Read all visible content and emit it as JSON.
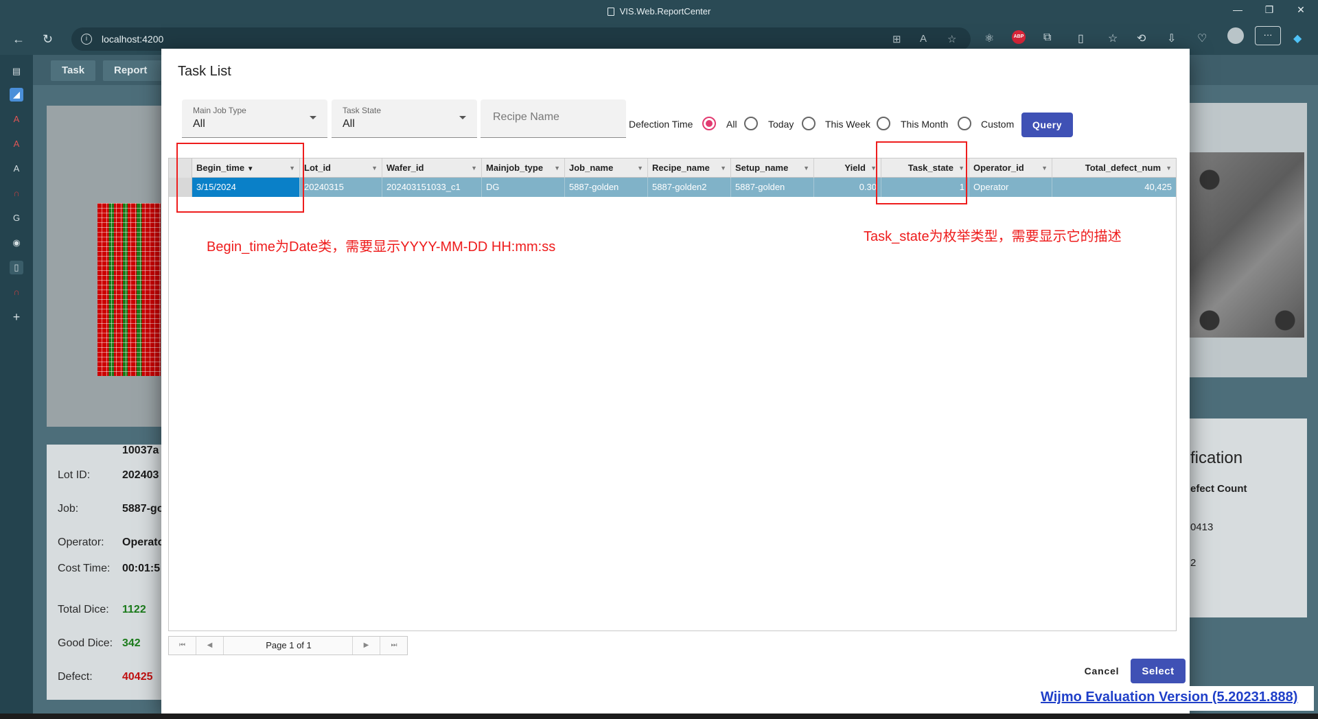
{
  "browser": {
    "window_title": "VIS.Web.ReportCenter",
    "url": "localhost:4200",
    "win_minimize": "—",
    "win_restore": "❐",
    "win_close": "✕",
    "abp_label": "ABP",
    "more_label": "···"
  },
  "background": {
    "tabs": [
      "Task",
      "Report Ex"
    ],
    "info_header": "10037a",
    "rows": [
      {
        "label": "Lot ID:",
        "value": "202403"
      },
      {
        "label": "Job:",
        "value": "5887-go"
      },
      {
        "label": "Operator:",
        "value": "Operato"
      },
      {
        "label": "Cost Time:",
        "value": "00:01:5"
      },
      {
        "label": "Total Dice:",
        "value": "1122"
      },
      {
        "label": "Good Dice:",
        "value": "342"
      },
      {
        "label": "Defect:",
        "value": "40425"
      }
    ],
    "right_title": "fication",
    "right_sub": "efect Count",
    "right_val1": "0413",
    "right_val2": "2",
    "colors": {
      "total": "#1a7a1a",
      "good": "#1a7a1a",
      "defect": "#c01010"
    }
  },
  "dialog": {
    "title": "Task List",
    "main_job_type": {
      "label": "Main Job Type",
      "value": "All"
    },
    "task_state": {
      "label": "Task State",
      "value": "All"
    },
    "recipe_name": {
      "placeholder": "Recipe Name"
    },
    "defection_time": {
      "label": "Defection Time",
      "options": [
        "All",
        "Today",
        "This Week",
        "This Month",
        "Custom"
      ],
      "selected": "All"
    },
    "query_label": "Query",
    "grid": {
      "columns": [
        "Begin_time",
        "Lot_id",
        "Wafer_id",
        "Mainjob_type",
        "Job_name",
        "Recipe_name",
        "Setup_name",
        "Yield",
        "Task_state",
        "Operator_id",
        "Total_defect_num"
      ],
      "sort_indicator": "▼",
      "filter_glyph": "▼",
      "rows": [
        [
          "3/15/2024",
          "20240315",
          "202403151033_c1",
          "DG",
          "5887-golden",
          "5887-golden2",
          "5887-golden",
          "0.30",
          "1",
          "Operator",
          "40,425"
        ]
      ]
    },
    "pager": {
      "text": "Page 1 of 1",
      "first": "⏮",
      "prev": "◀",
      "next": "▶",
      "last": "⏭"
    },
    "cancel_label": "Cancel",
    "select_label": "Select"
  },
  "annotations": {
    "begin_time_note": "Begin_time为Date类，需要显示YYYY-MM-DD HH:mm:ss",
    "task_state_note": "Task_state为枚举类型，需要显示它的描述",
    "color": "#ee1c1c"
  },
  "wijmo_notice": "Wijmo Evaluation Version (5.20231.888)"
}
